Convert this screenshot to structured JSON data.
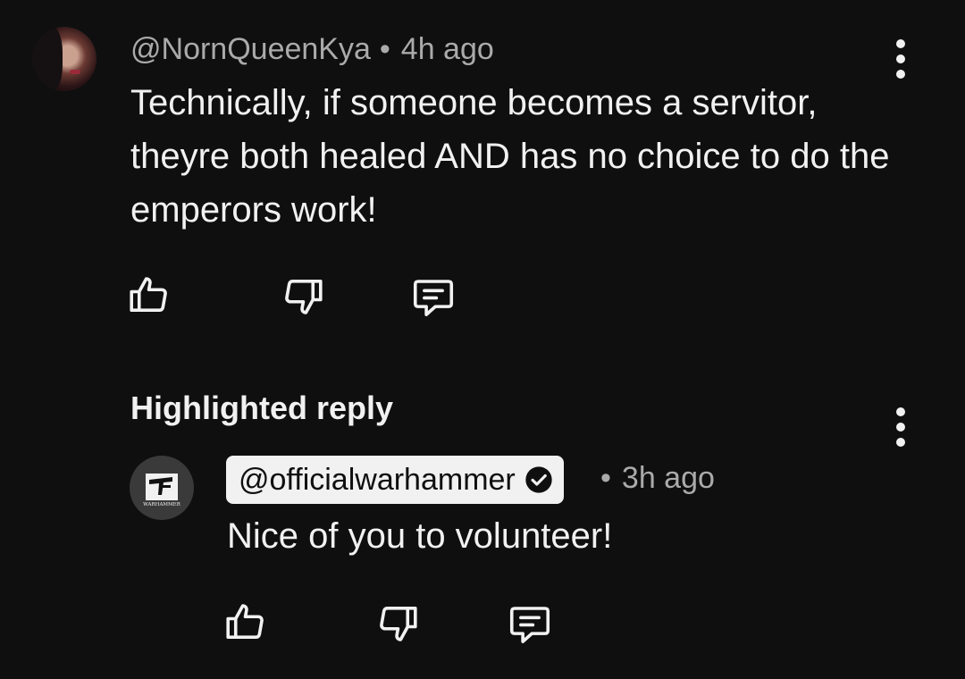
{
  "comment": {
    "username": "@NornQueenKya",
    "separator": "•",
    "time": "4h ago",
    "text": "Technically, if someone becomes a servitor, theyre both healed AND has no choice to do the emperors work!"
  },
  "reply_section": {
    "title": "Highlighted reply"
  },
  "reply": {
    "channel": "@officialwarhammer",
    "separator": "•",
    "time": "3h ago",
    "text": "Nice of you to volunteer!",
    "avatar_logo_text": "WARHAMMER"
  },
  "icons": {
    "like": "thumbs-up-icon",
    "dislike": "thumbs-down-icon",
    "reply": "comment-icon",
    "more": "more-vert-icon",
    "verified": "verified-check-icon"
  },
  "colors": {
    "background": "#0f0f0f",
    "text_primary": "#f1f1f1",
    "text_secondary": "#aaaaaa"
  }
}
